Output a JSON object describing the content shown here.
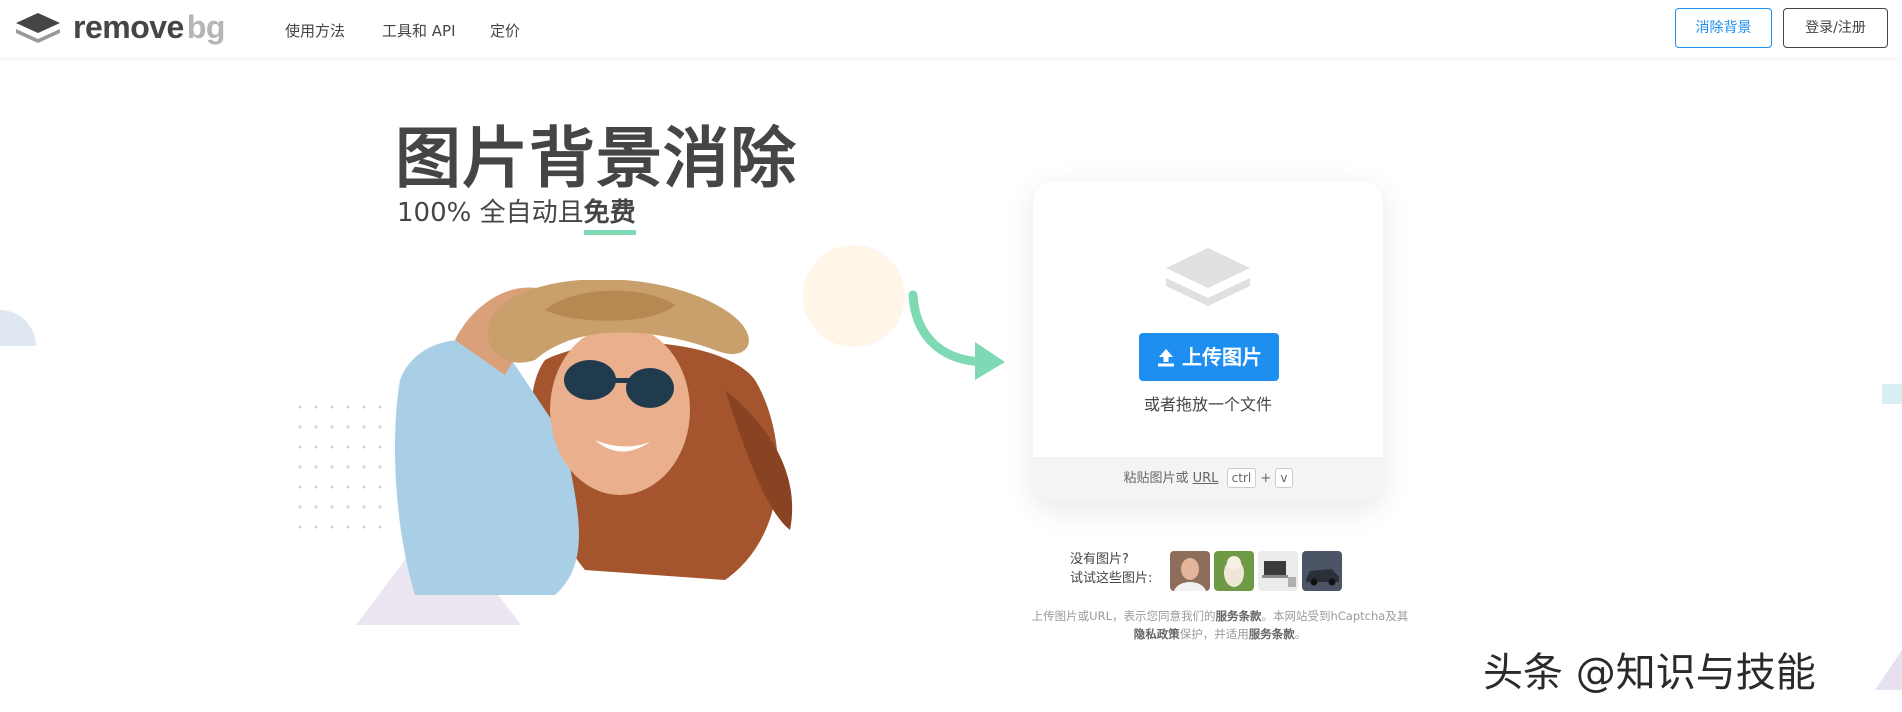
{
  "header": {
    "brand_remove": "remove",
    "brand_bg": "bg",
    "nav": [
      "使用方法",
      "工具和 API",
      "定价"
    ],
    "cta_remove": "消除背景",
    "cta_login": "登录/注册"
  },
  "hero": {
    "title": "图片背景消除",
    "subtitle_prefix": "100% 全自动且",
    "subtitle_free": "免费"
  },
  "upload": {
    "button_label": "上传图片",
    "drop_text": "或者拖放一个文件",
    "paste_prefix": "粘贴图片或 ",
    "paste_url": "URL",
    "key_ctrl": "ctrl",
    "key_plus": "+",
    "key_v": "v"
  },
  "samples": {
    "line1": "没有图片?",
    "line2": "试试这些图片:"
  },
  "terms": {
    "t1": "上传图片或URL，表示您同意我们的",
    "t2": "服务条款",
    "t3": "。本网站受到hCaptcha及其",
    "t4": "隐私政策",
    "t5": "保护，并适用",
    "t6": "服务条款",
    "t7": "。"
  },
  "watermark": "头条 @知识与技能",
  "colors": {
    "accent": "#1e8ff0",
    "text": "#454545",
    "highlight": "#7fd9b4"
  }
}
